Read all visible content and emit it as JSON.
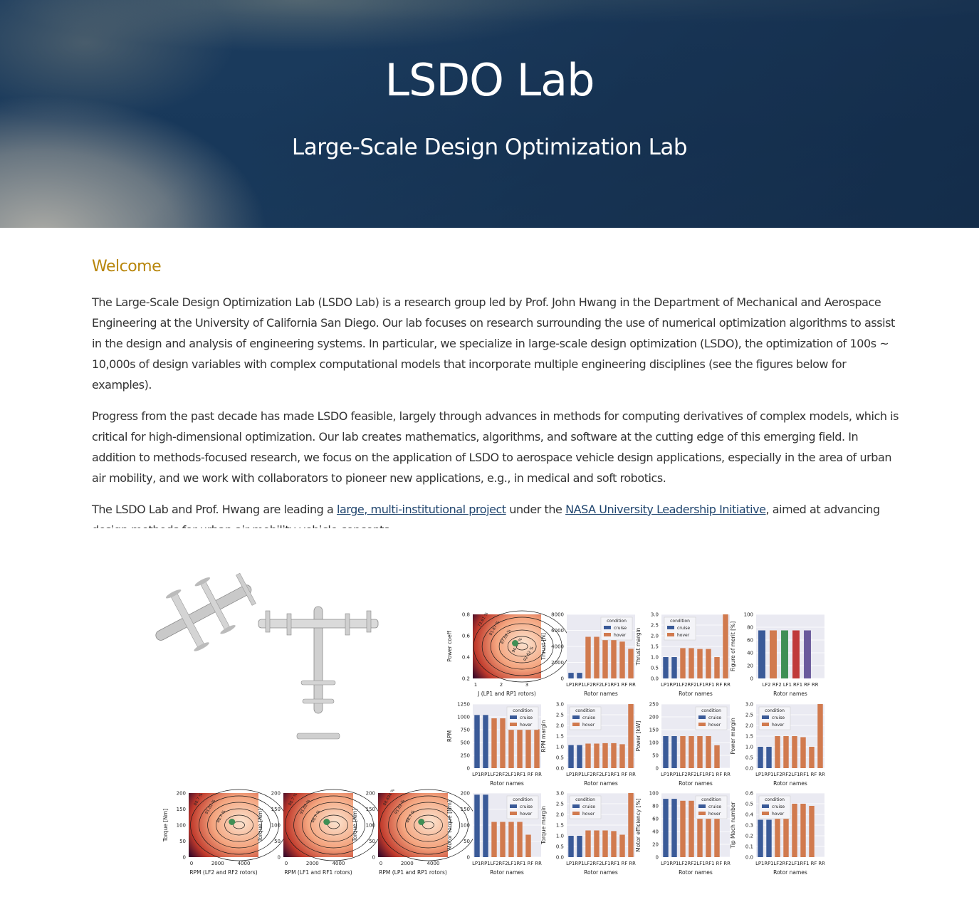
{
  "hero": {
    "title": "LSDO Lab",
    "subtitle": "Large-Scale Design Optimization Lab"
  },
  "welcome": {
    "heading": "Welcome",
    "p1": "The Large-Scale Design Optimization Lab (LSDO Lab) is a research group led by Prof. John Hwang in the Department of Mechanical and Aerospace Engineering at the University of California San Diego. Our lab focuses on research surrounding the use of numerical optimization algorithms to assist in the design and analysis of engineering systems. In particular, we specialize in large-scale design optimization (LSDO), the optimization of 100s ~ 10,000s of design variables with complex computational models that incorporate multiple engineering disciplines (see the figures below for examples).",
    "p2": "Progress from the past decade has made LSDO feasible, largely through advances in methods for computing derivatives of complex models, which is critical for high-dimensional optimization. Our lab creates mathematics, algorithms, and software at the cutting edge of this emerging field. In addition to methods-focused research, we focus on the application of LSDO to aerospace vehicle design applications, especially in the area of urban air mobility, and we work with collaborators to pioneer new applications, e.g., in medical and soft robotics.",
    "p3_before": "The LSDO Lab and Prof. Hwang are leading a ",
    "p3_link1": "large, multi-institutional project",
    "p3_middle": " under the ",
    "p3_link2": "NASA University Leadership Initiative",
    "p3_after": ", aimed at advancing design methods for urban air mobility vehicle concepts."
  },
  "colors": {
    "heading_accent": "#b8860b",
    "link": "#20456e",
    "cruise": "#3a5a98",
    "hover": "#d17a4e",
    "green": "#3f8f55",
    "red": "#c03a3a",
    "purple": "#6a5a9c"
  },
  "figure_text": {
    "legend_title": "condition",
    "legend_cruise": "cruise",
    "legend_hover": "hover",
    "rotor_names": "Rotor names",
    "rotor_ticks_8": "LP1RP1LF2RF2LF1RF1 RF RR",
    "rotor_ticks_6": "LF2  RF2  LF1  RF1   RF    RR"
  },
  "chart_data": [
    {
      "type": "heatmap",
      "title": "",
      "xlabel": "J (LP1 and RP1 rotors)",
      "ylabel": "Power coeff",
      "x_ticks": [
        "1",
        "2",
        "3"
      ],
      "y_ticks": [
        "0.2",
        "0.4",
        "0.6",
        "0.8"
      ],
      "contour_labels": [
        "73.61 %",
        "81.67 %",
        "87.02 %",
        "90.44 %",
        "92.62 %"
      ]
    },
    {
      "type": "bar",
      "xlabel": "Rotor names",
      "ylabel": "Thrust [N]",
      "y_ticks": [
        "0",
        "2000",
        "4000",
        "6000",
        "8000"
      ],
      "ylim": [
        0,
        8000
      ],
      "legend": "top-right",
      "categories": [
        "LP1",
        "RP1",
        "LF2",
        "RF2",
        "LF1",
        "RF1",
        "RF",
        "RR"
      ],
      "series": [
        {
          "name": "cruise",
          "values": [
            700,
            700,
            0,
            0,
            0,
            0,
            0,
            0
          ]
        },
        {
          "name": "hover",
          "values": [
            0,
            0,
            5200,
            5200,
            4800,
            4800,
            4600,
            3700
          ]
        }
      ]
    },
    {
      "type": "bar",
      "xlabel": "Rotor names",
      "ylabel": "Thrust margin",
      "y_ticks": [
        "0.0",
        "0.5",
        "1.0",
        "1.5",
        "2.0",
        "2.5",
        "3.0"
      ],
      "ylim": [
        0,
        3
      ],
      "legend": "top-left",
      "categories": [
        "LP1",
        "RP1",
        "LF2",
        "RF2",
        "LF1",
        "RF1",
        "RF",
        "RR"
      ],
      "series": [
        {
          "name": "cruise",
          "values": [
            1.0,
            1.0,
            0,
            0,
            0,
            0,
            0,
            0
          ]
        },
        {
          "name": "hover",
          "values": [
            0,
            0,
            1.42,
            1.42,
            1.38,
            1.38,
            1.0,
            3.0
          ]
        }
      ]
    },
    {
      "type": "bar",
      "xlabel": "Rotor names",
      "ylabel": "Figure of merit [%]",
      "y_ticks": [
        "0",
        "20",
        "40",
        "60",
        "80",
        "100"
      ],
      "ylim": [
        0,
        100
      ],
      "categories": [
        "LF2",
        "RF2",
        "LF1",
        "RF1",
        "RF",
        "RR"
      ],
      "values": [
        75,
        75,
        75,
        75,
        75,
        0
      ]
    },
    {
      "type": "bar",
      "xlabel": "Rotor names",
      "ylabel": "RPM",
      "y_ticks": [
        "0",
        "250",
        "500",
        "750",
        "1000",
        "1250"
      ],
      "ylim": [
        0,
        1350
      ],
      "legend": "top-right",
      "categories": [
        "LP1",
        "RP1",
        "LF2",
        "RF2",
        "LF1",
        "RF1",
        "RF",
        "RR"
      ],
      "series": [
        {
          "name": "cruise",
          "values": [
            1120,
            1120,
            0,
            0,
            0,
            0,
            0,
            0
          ]
        },
        {
          "name": "hover",
          "values": [
            0,
            0,
            1050,
            1050,
            960,
            960,
            900,
            820
          ]
        }
      ]
    },
    {
      "type": "bar",
      "xlabel": "Rotor names",
      "ylabel": "RPM margin",
      "y_ticks": [
        "0.0",
        "0.5",
        "1.0",
        "1.5",
        "2.0",
        "2.5",
        "3.0"
      ],
      "ylim": [
        0,
        3
      ],
      "legend": "top-left",
      "categories": [
        "LP1",
        "RP1",
        "LF2",
        "RF2",
        "LF1",
        "RF1",
        "RF",
        "RR"
      ],
      "series": [
        {
          "name": "cruise",
          "values": [
            1.08,
            1.08,
            0,
            0,
            0,
            0,
            0,
            0
          ]
        },
        {
          "name": "hover",
          "values": [
            0,
            0,
            1.15,
            1.15,
            1.17,
            1.17,
            1.12,
            3.0
          ]
        }
      ]
    },
    {
      "type": "bar",
      "xlabel": "Rotor names",
      "ylabel": "Power [kW]",
      "y_ticks": [
        "0",
        "50",
        "100",
        "150",
        "200",
        "250"
      ],
      "ylim": [
        0,
        280
      ],
      "legend": "top-right",
      "categories": [
        "LP1",
        "RP1",
        "LF2",
        "RF2",
        "LF1",
        "RF1",
        "RF",
        "RR"
      ],
      "series": [
        {
          "name": "cruise",
          "values": [
            140,
            140,
            0,
            0,
            0,
            0,
            0,
            0
          ]
        },
        {
          "name": "hover",
          "values": [
            0,
            0,
            140,
            140,
            140,
            140,
            100,
            0
          ]
        }
      ]
    },
    {
      "type": "bar",
      "xlabel": "Rotor names",
      "ylabel": "Power margin",
      "y_ticks": [
        "0.0",
        "0.5",
        "1.0",
        "1.5",
        "2.0",
        "2.5",
        "3.0"
      ],
      "ylim": [
        0,
        3
      ],
      "legend": "top-left",
      "categories": [
        "LP1",
        "RP1",
        "LF2",
        "RF2",
        "LF1",
        "RF1",
        "RF",
        "RR"
      ],
      "series": [
        {
          "name": "cruise",
          "values": [
            1.0,
            1.0,
            0,
            0,
            0,
            0,
            0,
            0
          ]
        },
        {
          "name": "hover",
          "values": [
            0,
            0,
            1.5,
            1.5,
            1.5,
            1.45,
            1.0,
            3.0
          ]
        }
      ]
    },
    {
      "type": "heatmap",
      "xlabel": "RPM (LF2 and RF2 rotors)",
      "ylabel": "Torque [Nm]",
      "x_ticks": [
        "0",
        "2000",
        "4000"
      ],
      "y_ticks": [
        "0",
        "50",
        "100",
        "150",
        "200"
      ],
      "contour_labels": [
        "88.7 %",
        "91.02 %",
        "88.7 %"
      ]
    },
    {
      "type": "heatmap",
      "xlabel": "RPM (LF1 and RF1 rotors)",
      "ylabel": "Torque [Nm]",
      "x_ticks": [
        "0",
        "2000",
        "4000"
      ],
      "y_ticks": [
        "0",
        "50",
        "100",
        "150",
        "200"
      ],
      "contour_labels": [
        "88.7 %",
        "91.02 %",
        "88.7 %"
      ]
    },
    {
      "type": "heatmap",
      "xlabel": "RPM (LP1 and RP1 rotors)",
      "ylabel": "Torque [Nm]",
      "x_ticks": [
        "0",
        "2000",
        "4000"
      ],
      "y_ticks": [
        "0",
        "50",
        "100",
        "150",
        "200"
      ],
      "contour_labels": [
        "88.694 %",
        "91.02 %",
        "88.7 %"
      ]
    },
    {
      "type": "bar",
      "xlabel": "Rotor names",
      "ylabel": "Motor torque [Nm]",
      "y_ticks": [
        "0",
        "50",
        "100",
        "150",
        "200"
      ],
      "ylim": [
        0,
        200
      ],
      "legend": "top-right",
      "categories": [
        "LP1",
        "RP1",
        "LF2",
        "RF2",
        "LF1",
        "RF1",
        "RF",
        "RR"
      ],
      "series": [
        {
          "name": "cruise",
          "values": [
            195,
            195,
            0,
            0,
            0,
            0,
            0,
            0
          ]
        },
        {
          "name": "hover",
          "values": [
            0,
            0,
            110,
            110,
            110,
            110,
            70,
            0
          ]
        }
      ]
    },
    {
      "type": "bar",
      "xlabel": "Rotor names",
      "ylabel": "Torque margin",
      "y_ticks": [
        "0.0",
        "0.5",
        "1.0",
        "1.5",
        "2.0",
        "2.5",
        "3.0"
      ],
      "ylim": [
        0,
        3
      ],
      "legend": "top-left",
      "categories": [
        "LP1",
        "RP1",
        "LF2",
        "RF2",
        "LF1",
        "RF1",
        "RF",
        "RR"
      ],
      "series": [
        {
          "name": "cruise",
          "values": [
            1.0,
            1.0,
            0,
            0,
            0,
            0,
            0,
            0
          ]
        },
        {
          "name": "hover",
          "values": [
            0,
            0,
            1.25,
            1.25,
            1.25,
            1.22,
            1.05,
            3.0
          ]
        }
      ]
    },
    {
      "type": "bar",
      "xlabel": "Rotor names",
      "ylabel": "Motor efficiency [%]",
      "y_ticks": [
        "0",
        "20",
        "40",
        "60",
        "80",
        "100"
      ],
      "ylim": [
        0,
        100
      ],
      "legend": "top-right",
      "categories": [
        "LP1",
        "RP1",
        "LF2",
        "RF2",
        "LF1",
        "RF1",
        "RF",
        "RR"
      ],
      "series": [
        {
          "name": "cruise",
          "values": [
            91,
            91,
            0,
            0,
            0,
            0,
            0,
            0
          ]
        },
        {
          "name": "hover",
          "values": [
            0,
            0,
            88,
            88,
            88,
            86,
            85,
            0
          ]
        }
      ]
    },
    {
      "type": "bar",
      "xlabel": "Rotor names",
      "ylabel": "Tip Mach number",
      "y_ticks": [
        "0.0",
        "0.1",
        "0.2",
        "0.3",
        "0.4",
        "0.5",
        "0.6"
      ],
      "ylim": [
        0,
        0.6
      ],
      "legend": "top-left",
      "categories": [
        "LP1",
        "RP1",
        "LF2",
        "RF2",
        "LF1",
        "RF1",
        "RF",
        "RR"
      ],
      "series": [
        {
          "name": "cruise",
          "values": [
            0.35,
            0.35,
            0,
            0,
            0,
            0,
            0,
            0
          ]
        },
        {
          "name": "hover",
          "values": [
            0,
            0,
            0.5,
            0.5,
            0.5,
            0.5,
            0.48,
            0
          ]
        }
      ]
    }
  ]
}
